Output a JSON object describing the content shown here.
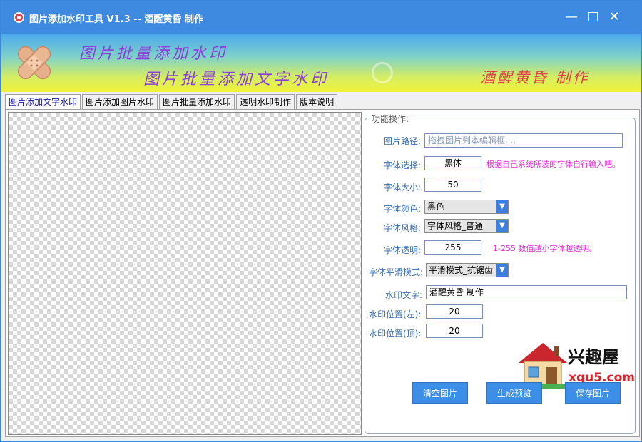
{
  "window": {
    "title": "图片添加水印工具 V1.3 -- 酒醒黄昏 制作",
    "minimize_label": "—",
    "close_label": "✕"
  },
  "banner": {
    "line1": "图片批量添加水印",
    "line2": "图片批量添加文字水印",
    "signature": "酒醒黄昏 制作"
  },
  "tabs": [
    {
      "label": "图片添加文字水印",
      "active": true
    },
    {
      "label": "图片添加图片水印",
      "active": false
    },
    {
      "label": "图片批量添加水印",
      "active": false
    },
    {
      "label": "透明水印制作",
      "active": false
    },
    {
      "label": "版本说明",
      "active": false
    }
  ],
  "panel": {
    "legend": "功能操作:",
    "image_path": {
      "label": "图片路径:",
      "placeholder": "拖拽图片到本编辑框...."
    },
    "font_select": {
      "label": "字体选择:",
      "value": "黑体",
      "hint": "根据自己系统所装的字体自行输入吧。"
    },
    "font_size": {
      "label": "字体大小:",
      "value": "50"
    },
    "font_color": {
      "label": "字体颜色:",
      "value": "黑色"
    },
    "font_style": {
      "label": "字体风格:",
      "value": "字体风格_普通"
    },
    "font_opacity": {
      "label": "字体透明:",
      "value": "255",
      "hint": "1-255   数值越小字体越透明。"
    },
    "smooth_mode": {
      "label": "字体平滑模式:",
      "value": "平滑模式_抗锯齿"
    },
    "watermark_text": {
      "label": "水印文字:",
      "value": "酒醒黄昏 制作"
    },
    "pos_left": {
      "label": "水印位置(左):",
      "value": "20"
    },
    "pos_top": {
      "label": "水印位置(顶):",
      "value": "20"
    },
    "buttons": {
      "clear": "清空图片",
      "preview": "生成预览",
      "save": "保存图片"
    }
  },
  "site_logo": {
    "name": "兴趣屋",
    "url": "xqu5.com"
  },
  "colors": {
    "title_bar": "#3d8ae0",
    "accent_button": "#3c8ee6",
    "hint": "#e02bd3",
    "label": "#3a6fb0",
    "banner_text": "#8a40d8",
    "signature": "#e0404a"
  }
}
